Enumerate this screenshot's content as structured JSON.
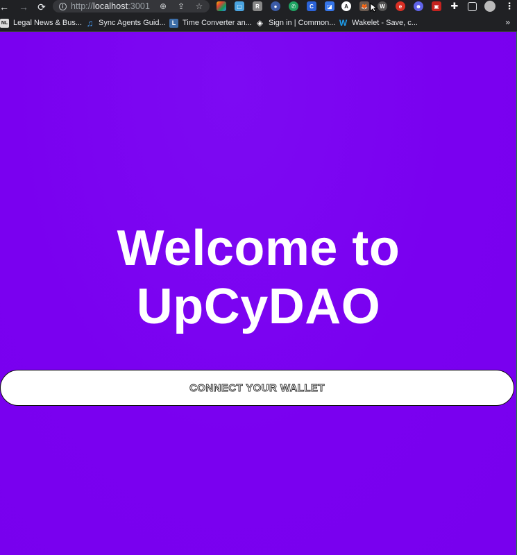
{
  "browser": {
    "url_scheme": "http://",
    "url_host": "localhost",
    "url_port": ":3001",
    "bookmarks": [
      {
        "label": "Legal News & Bus...",
        "icon": "newspaper-icon"
      },
      {
        "label": "Sync Agents Guid...",
        "icon": "music-note-icon"
      },
      {
        "label": "Time Converter an...",
        "icon": "clock-icon"
      },
      {
        "label": "Sign in | Common...",
        "icon": "diamond-icon"
      },
      {
        "label": "Wakelet - Save, c...",
        "icon": "wakelet-icon"
      }
    ],
    "more_bookmarks": "»"
  },
  "hero": {
    "title_line1": "Welcome to",
    "title_line2": "UpCyDAO"
  },
  "actions": {
    "connect_label": "CONNECT YOUR WALLET"
  },
  "colors": {
    "page_background": "#7a00f0",
    "title_text": "#ffffff",
    "button_background": "#ffffff"
  }
}
